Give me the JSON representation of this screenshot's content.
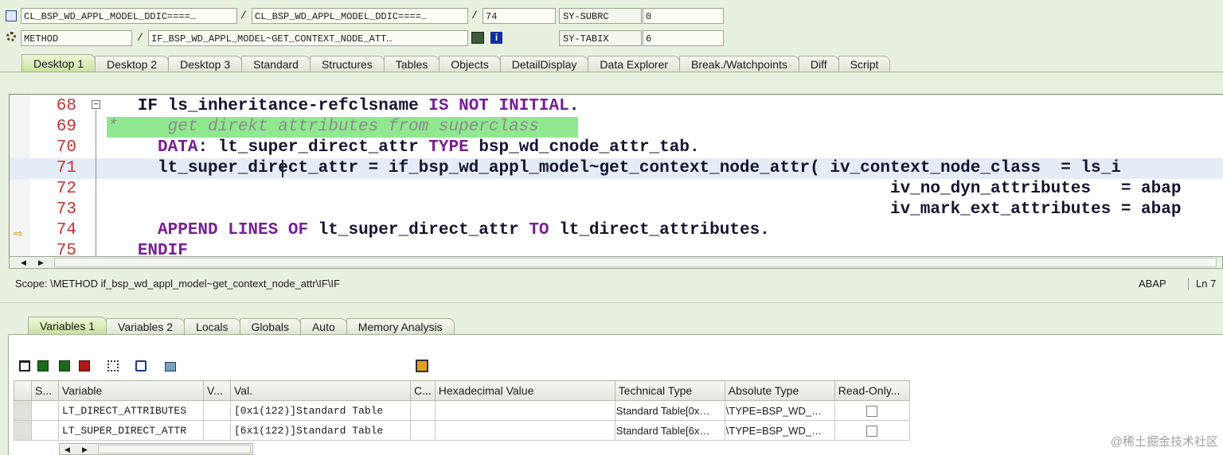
{
  "header": {
    "row1": {
      "program": "CL_BSP_WD_APPL_MODEL_DDIC====…",
      "include": "CL_BSP_WD_APPL_MODEL_DDIC====…",
      "line": "74",
      "sy1_label": "SY-SUBRC",
      "sy1_value": "0"
    },
    "row2": {
      "event_type": "METHOD",
      "event_name": "IF_BSP_WD_APPL_MODEL~GET_CONTEXT_NODE_ATT…",
      "sy2_label": "SY-TABIX",
      "sy2_value": "6"
    }
  },
  "desktop_tabs": [
    "Desktop 1",
    "Desktop 2",
    "Desktop 3",
    "Standard",
    "Structures",
    "Tables",
    "Objects",
    "DetailDisplay",
    "Data Explorer",
    "Break./Watchpoints",
    "Diff",
    "Script"
  ],
  "editor": {
    "lines": [
      {
        "no": "68",
        "indent": "   ",
        "parts": [
          {
            "t": "IF ",
            "c": "code"
          },
          {
            "t": "ls_inheritance-refclsname ",
            "c": "code"
          },
          {
            "t": "IS NOT INITIAL",
            "c": "kw"
          },
          {
            "t": ".",
            "c": "code"
          }
        ]
      },
      {
        "no": "69",
        "indent": "",
        "parts": [
          {
            "t": "*     get direkt attributes from superclass",
            "c": "cm"
          }
        ]
      },
      {
        "no": "70",
        "indent": "     ",
        "parts": [
          {
            "t": "DATA",
            "c": "kw"
          },
          {
            "t": ": lt_super_direct_attr ",
            "c": "code"
          },
          {
            "t": "TYPE ",
            "c": "kw"
          },
          {
            "t": "bsp_wd_cnode_attr_tab.",
            "c": "code"
          }
        ]
      },
      {
        "no": "71",
        "indent": "     ",
        "parts": [
          {
            "t": "lt_super_direct_attr = if_bsp_wd_appl_model~get_context_node_attr( iv_context_node_class  = ls_i",
            "c": "code"
          }
        ]
      },
      {
        "no": "72",
        "indent": "                                                         ",
        "parts": [
          {
            "t": "                     iv_no_dyn_attributes   = abap",
            "c": "code"
          }
        ]
      },
      {
        "no": "73",
        "indent": "                                                         ",
        "parts": [
          {
            "t": "                     iv_mark_ext_attributes = abap",
            "c": "code"
          }
        ]
      },
      {
        "no": "74",
        "indent": "     ",
        "parts": [
          {
            "t": "APPEND LINES OF ",
            "c": "kw"
          },
          {
            "t": "lt_super_direct_attr ",
            "c": "code"
          },
          {
            "t": "TO ",
            "c": "kw"
          },
          {
            "t": "lt_direct_attributes.",
            "c": "code"
          }
        ]
      },
      {
        "no": "75",
        "indent": "   ",
        "parts": [
          {
            "t": "ENDIF",
            "c": "kw"
          }
        ]
      }
    ]
  },
  "status": {
    "scope": "Scope: \\METHOD if_bsp_wd_appl_model~get_context_node_attr\\IF\\IF",
    "language": "ABAP",
    "position": "Ln 7"
  },
  "variable_tabs": [
    "Variables 1",
    "Variables 2",
    "Locals",
    "Globals",
    "Auto",
    "Memory Analysis"
  ],
  "grid": {
    "columns": [
      "S...",
      "Variable",
      "V...",
      "Val.",
      "C...",
      "Hexadecimal Value",
      "Technical Type",
      "Absolute Type",
      "Read-Only..."
    ],
    "rows": [
      {
        "variable": "LT_DIRECT_ATTRIBUTES",
        "value": "[0x1(122)]Standard Table",
        "technical": "Standard Table[0x…",
        "absolute": "\\TYPE=BSP_WD_…"
      },
      {
        "variable": "LT_SUPER_DIRECT_ATTR",
        "value": "[6x1(122)]Standard Table",
        "technical": "Standard Table[6x…",
        "absolute": "\\TYPE=BSP_WD_…"
      }
    ]
  },
  "watermark": "@稀土掘金技术社区",
  "colors": {
    "accent_tab": "#c8e2a0",
    "line_number": "#c83232",
    "keyword": "#781e96",
    "comment_highlight": "#90e890"
  }
}
